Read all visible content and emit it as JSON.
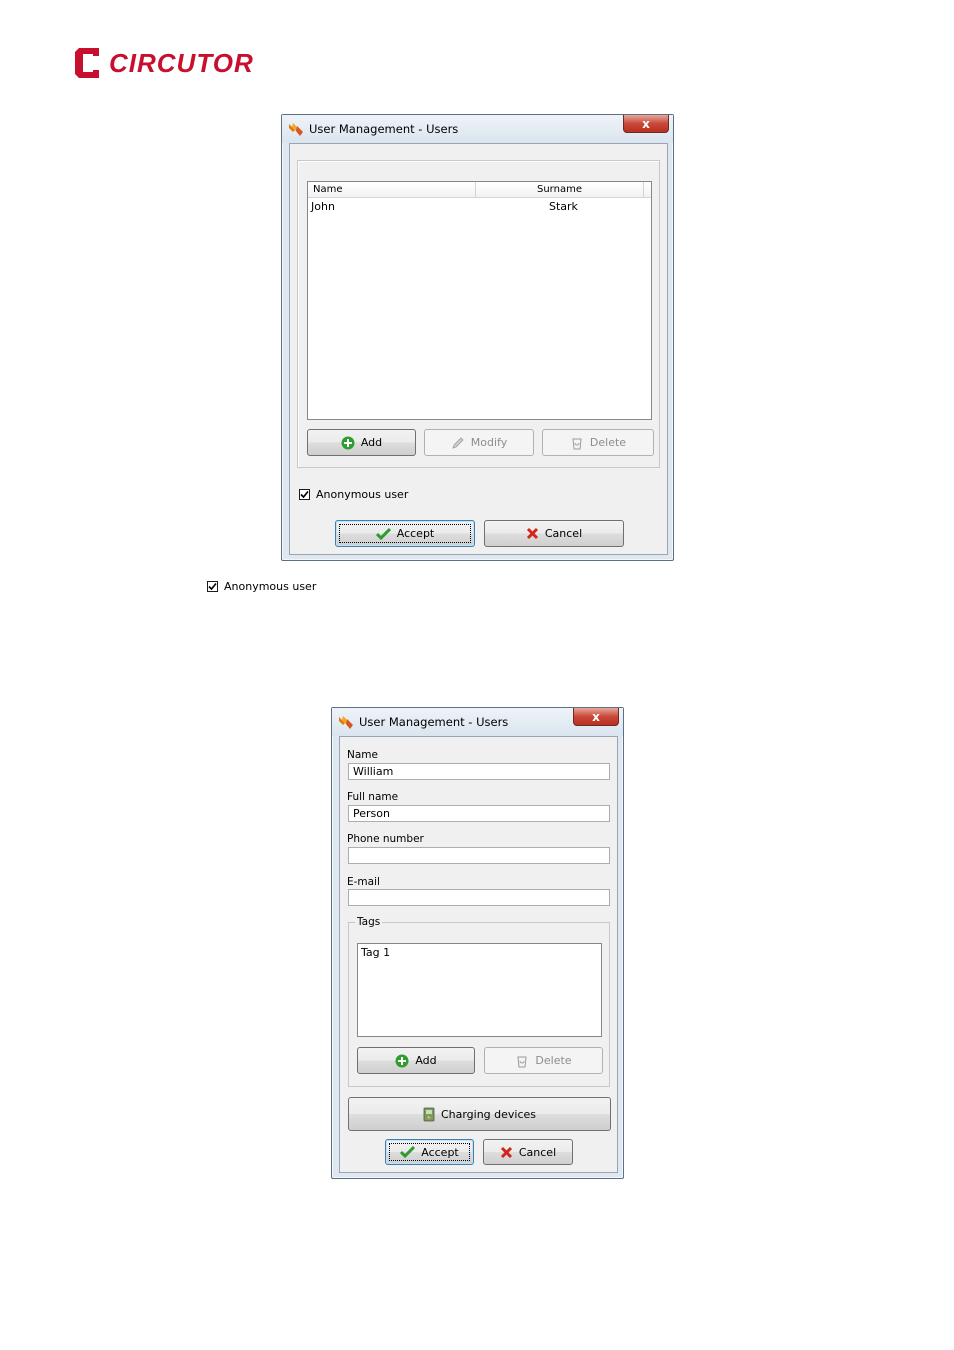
{
  "brand": {
    "name": "CIRCUTOR",
    "color": "#c8102e"
  },
  "users_dialog": {
    "title": "User Management - Users",
    "close_glyph": "x",
    "columns": [
      "Name",
      "Surname"
    ],
    "rows": [
      {
        "name": "John",
        "surname": "Stark"
      }
    ],
    "add_label": "Add",
    "modify_label": "Modify",
    "delete_label": "Delete",
    "anonymous_label": "Anonymous user",
    "anonymous_checked": true,
    "accept_label": "Accept",
    "cancel_label": "Cancel"
  },
  "standalone_checkbox": {
    "label": "Anonymous user",
    "checked": true
  },
  "edit_dialog": {
    "title": "User Management - Users",
    "close_glyph": "x",
    "name_label": "Name",
    "name_value": "William",
    "fullname_label": "Full name",
    "fullname_value": "Person",
    "phone_label": "Phone number",
    "phone_value": "",
    "email_label": "E-mail",
    "email_value": "",
    "tags_label": "Tags",
    "tags": [
      "Tag 1"
    ],
    "tags_add_label": "Add",
    "tags_delete_label": "Delete",
    "charging_devices_label": "Charging devices",
    "accept_label": "Accept",
    "cancel_label": "Cancel"
  },
  "icons": {
    "add": "green-plus-icon",
    "modify": "pencil-icon",
    "delete": "recycle-bin-icon",
    "accept": "green-check-icon",
    "cancel": "red-x-icon",
    "charging": "charging-device-icon"
  }
}
